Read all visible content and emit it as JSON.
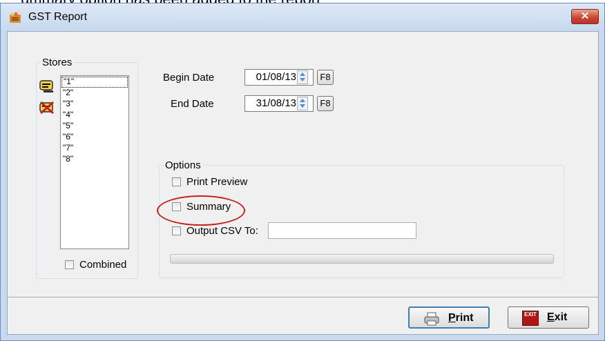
{
  "caption_fragment": "ummary option has been added to the report",
  "window": {
    "title": "GST Report",
    "close_glyph": "✕"
  },
  "stores": {
    "legend": "Stores",
    "items": [
      "\"1\"",
      "\"2\"",
      "\"3\"",
      "\"4\"",
      "\"5\"",
      "\"6\"",
      "\"7\"",
      "\"8\""
    ],
    "selected_index": 0,
    "combined_label": "Combined",
    "combined_checked": false,
    "icons": [
      "select-all-icon",
      "deselect-all-icon"
    ]
  },
  "dates": {
    "begin_label": "Begin Date",
    "begin_value": "01/08/13",
    "end_label": "End Date",
    "end_value": "31/08/13",
    "f8_label": "F8"
  },
  "options": {
    "legend": "Options",
    "print_preview_label": "Print Preview",
    "print_preview_checked": false,
    "summary_label": "Summary",
    "summary_checked": false,
    "csv_label": "Output CSV To:",
    "csv_checked": false,
    "csv_value": "",
    "progress": 0
  },
  "buttons": {
    "print_label": "Print",
    "exit_label": "Exit",
    "exit_icon_text": "EXIT"
  },
  "colors": {
    "accent": "#3c7fb1",
    "highlight": "#c8201e",
    "window_frame": "#c9daf0"
  }
}
